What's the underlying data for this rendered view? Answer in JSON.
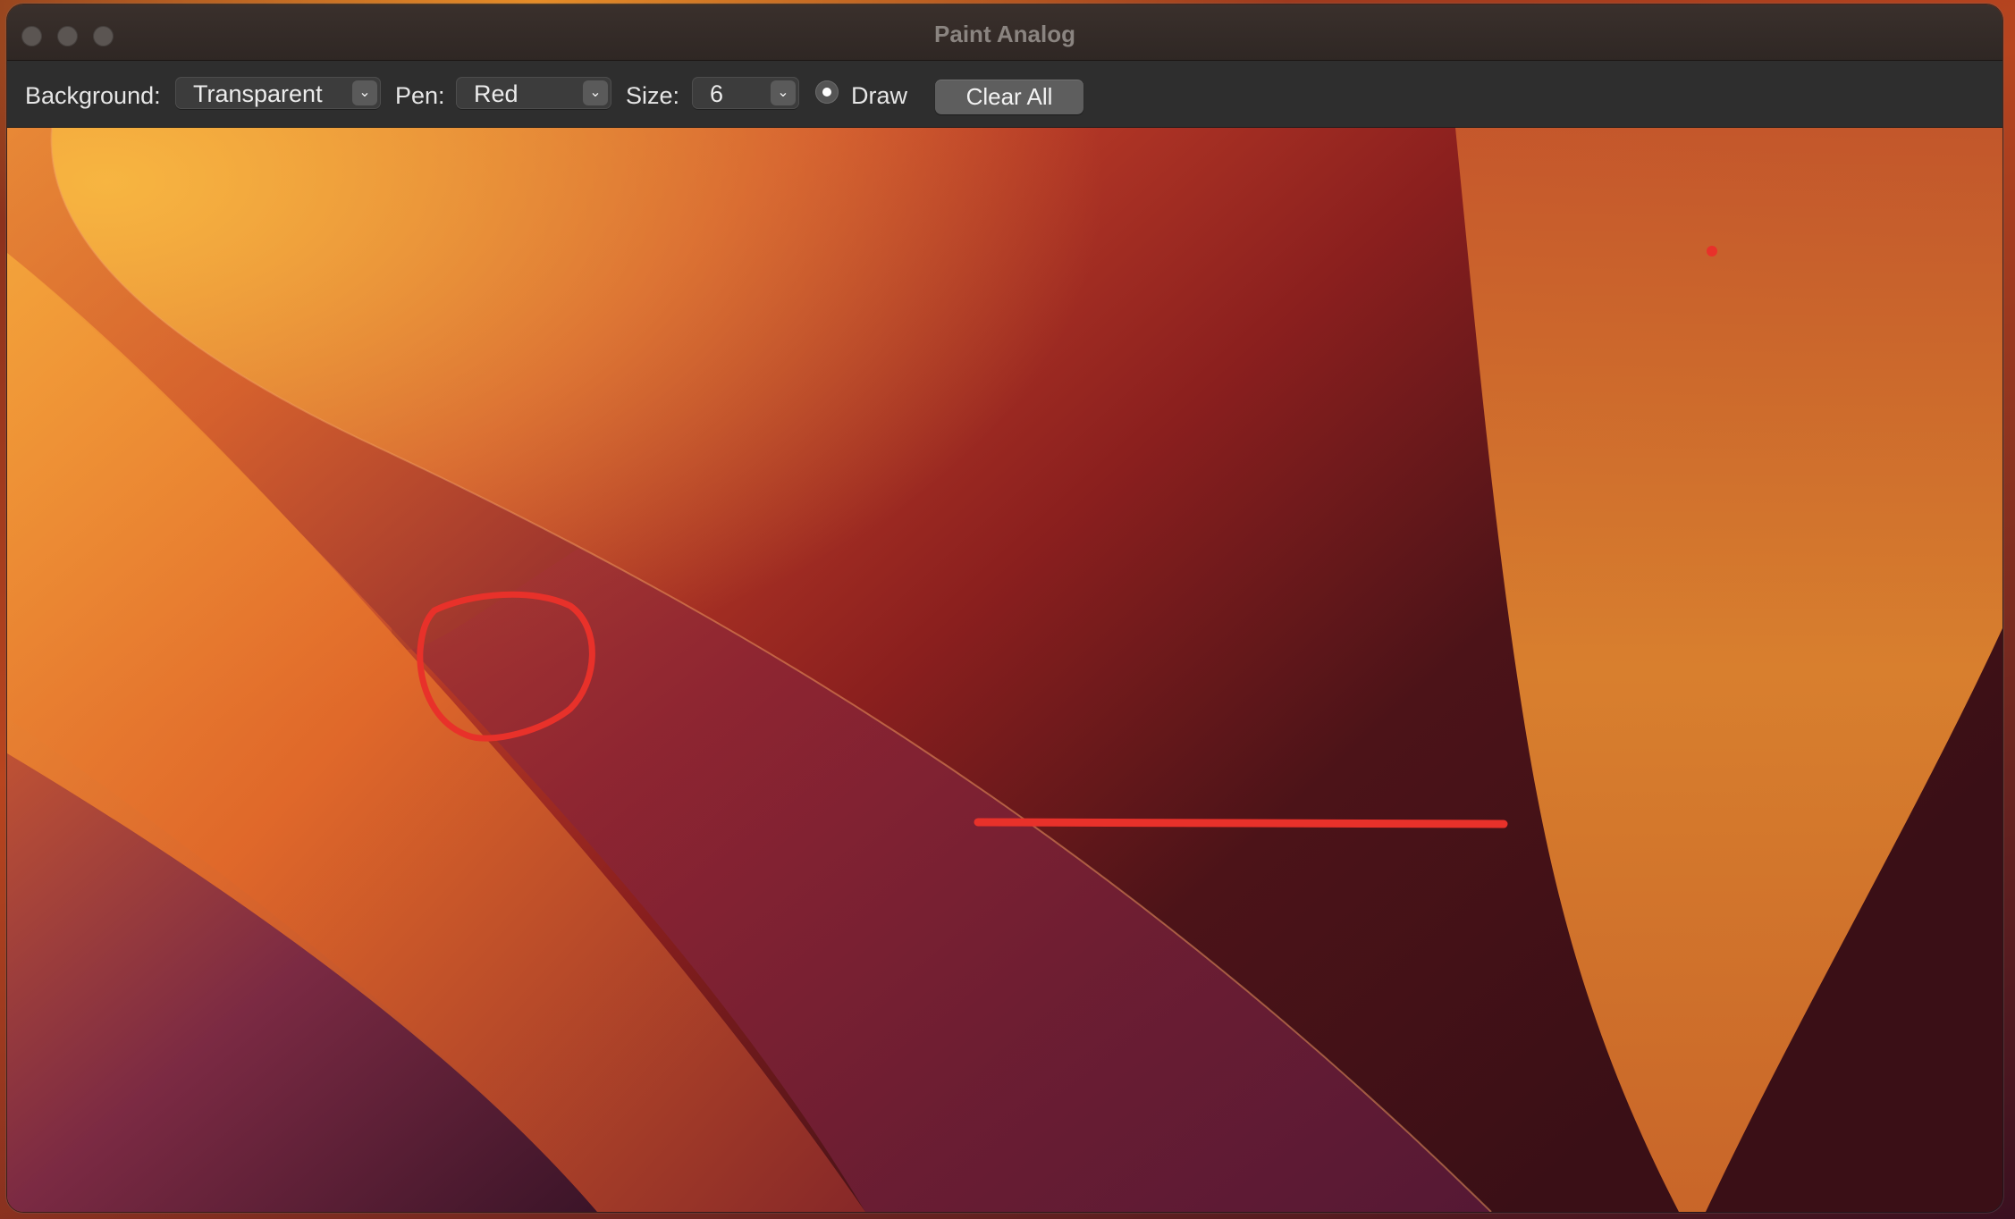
{
  "window": {
    "title": "Paint Analog"
  },
  "toolbar": {
    "background_label": "Background:",
    "background_value": "Transparent",
    "pen_label": "Pen:",
    "pen_value": "Red",
    "size_label": "Size:",
    "size_value": "6",
    "draw_label": "Draw",
    "draw_selected": true,
    "clear_label": "Clear All"
  },
  "icons": {
    "traffic_lights": [
      "close-button",
      "minimize-button",
      "zoom-button"
    ],
    "dropdown": "chevron-down-icon"
  },
  "colors": {
    "pen": "#e8312a"
  }
}
